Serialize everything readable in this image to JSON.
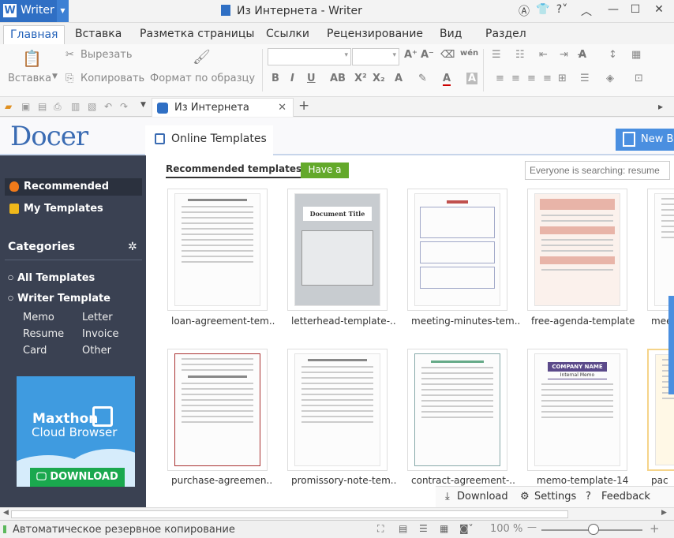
{
  "app": {
    "name": "Writer",
    "title": "Из Интернета - Writer"
  },
  "menu": [
    "Главная",
    "Вставка",
    "Разметка страницы",
    "Ссылки",
    "Рецензирование",
    "Вид",
    "Раздел"
  ],
  "ribbon": {
    "paste": "Вставка",
    "cut": "Вырезать",
    "copy": "Копировать",
    "format_painter": "Формат по образцу"
  },
  "doc_tab": {
    "title": "Из Интернета"
  },
  "docer": {
    "logo": "Docer",
    "online_templates": "Online Templates",
    "new_button": "New B"
  },
  "sidebar": {
    "recommended": "Recommended",
    "my_templates": "My Templates",
    "categories": "Categories",
    "all_templates": "All Templates",
    "writer_template": "Writer Template",
    "subs": [
      "Memo",
      "Letter",
      "Resume",
      "Invoice",
      "Card",
      "Other"
    ]
  },
  "ad": {
    "brand": "Maxthon",
    "product": "Cloud Browser",
    "download": "DOWNLOAD"
  },
  "main": {
    "recommended_tab": "Recommended templates",
    "try_button": "Have a try",
    "search_placeholder": "Everyone is searching: resume"
  },
  "templates": [
    {
      "name": "loan-agreement-tem.."
    },
    {
      "name": "letterhead-template-.."
    },
    {
      "name": "meeting-minutes-tem.."
    },
    {
      "name": "free-agenda-template"
    },
    {
      "name": "mee"
    },
    {
      "name": "purchase-agreemen.."
    },
    {
      "name": "promissory-note-tem.."
    },
    {
      "name": "contract-agreement-.."
    },
    {
      "name": "memo-template-14"
    },
    {
      "name": "pac"
    }
  ],
  "thumb_titles": {
    "letterhead": "Document Title",
    "memo_company": "COMPANY NAME",
    "memo_sub": "Internal Memo"
  },
  "bottom_bar": {
    "download": "Download",
    "settings": "Settings",
    "feedback": "Feedback"
  },
  "status": {
    "text": "Автоматическое резервное копирование",
    "zoom": "100 %"
  },
  "colors": {
    "accent": "#2f6fc4",
    "sidebar": "#3a4152",
    "try_green": "#63a92a"
  }
}
